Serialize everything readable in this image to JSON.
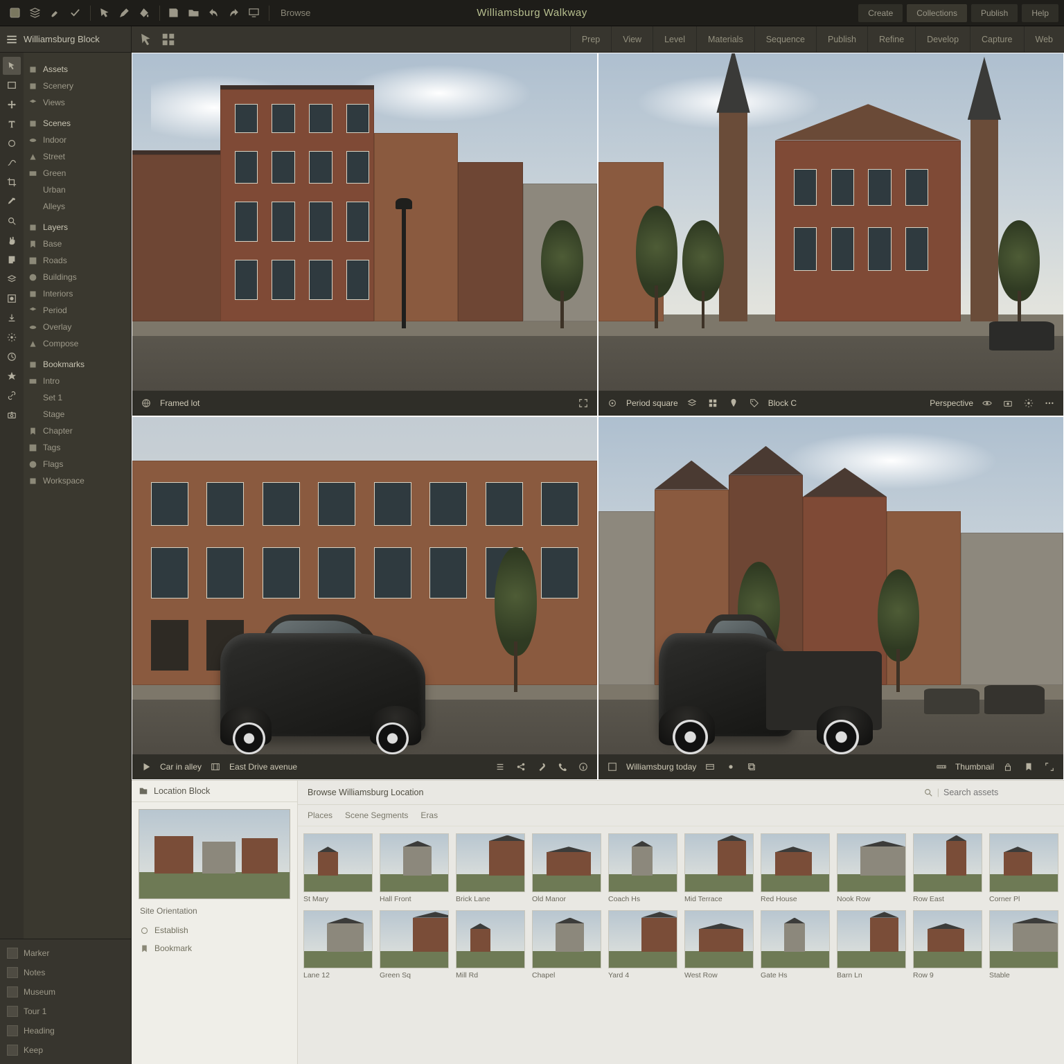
{
  "app_title": "Williamsburg Walkway",
  "top_right": [
    "Create",
    "Collections",
    "Publish",
    "Help"
  ],
  "topbar_label": "Browse",
  "crumb_title": "Williamsburg Block",
  "crumb_tabs": [
    "Prep",
    "View",
    "Level",
    "Materials",
    "Sequence",
    "Publish",
    "Refine",
    "Develop",
    "Capture",
    "Web"
  ],
  "sidebar": {
    "groups": [
      {
        "title": "Assets",
        "items": [
          "Scenery",
          "Views"
        ]
      },
      {
        "title": "Scenes",
        "items": [
          "Indoor",
          "Street",
          "Green",
          "Urban",
          "Alleys"
        ]
      },
      {
        "title": "Layers",
        "items": [
          "Base",
          "Roads",
          "Buildings",
          "Interiors",
          "Period",
          "Overlay",
          "Compose"
        ]
      },
      {
        "title": "Bookmarks",
        "items": [
          "Intro",
          "Set 1",
          "Stage",
          "Chapter",
          "Tags",
          "Flags",
          "Workspace"
        ]
      }
    ]
  },
  "left_lower": [
    "Marker",
    "Notes",
    "Museum",
    "Tour 1",
    "Heading",
    "Keep"
  ],
  "cells": [
    {
      "caption": "Framed lot",
      "meta": ""
    },
    {
      "caption": "Period square",
      "meta": "Block C",
      "extra": "Perspective"
    },
    {
      "caption": "Car in alley",
      "meta": "East Drive avenue"
    },
    {
      "caption": "Williamsburg today",
      "meta": "Thumbnail"
    }
  ],
  "browser": {
    "left_title": "Location Block",
    "left_caption": "Site Orientation",
    "left_rows": [
      "Establish",
      "Bookmark"
    ],
    "head_title": "Browse Williamsburg Location",
    "segments": [
      "Places",
      "Scene Segments",
      "Eras"
    ],
    "search_placeholder": "Search assets",
    "thumbs": [
      "St Mary",
      "Hall Front",
      "Brick Lane",
      "Old Manor",
      "Coach Hs",
      "Mid Terrace",
      "Red House",
      "Nook Row",
      "Row East",
      "Corner Pl",
      "Lane 12",
      "Green Sq",
      "Mill Rd",
      "Chapel",
      "Yard 4",
      "West Row",
      "Gate Hs",
      "Barn Ln",
      "Row 9",
      "Stable"
    ]
  }
}
